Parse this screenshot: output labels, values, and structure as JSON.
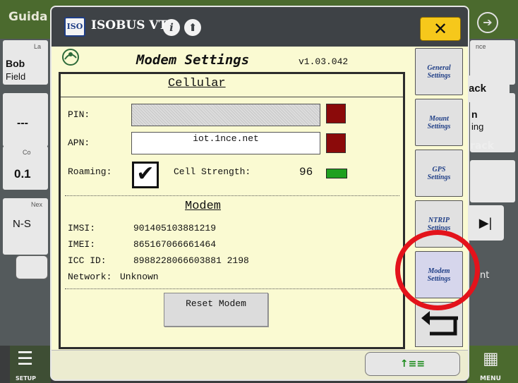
{
  "background_app": {
    "title": "Guida",
    "left_cards": [
      "Bob",
      "Field",
      "---",
      "0.1",
      "N-S"
    ],
    "left_card_small_labels": [
      "La",
      "Co",
      "Nex"
    ],
    "right_cards": [
      "ack",
      "n",
      "ing",
      "rack",
      "nt"
    ],
    "right_small_label": "nce",
    "setup_label": "SETUP",
    "menu_label": "MENU"
  },
  "dialog": {
    "title": "ISOBUS VT",
    "logo_text": "ISO",
    "close_symbol": "✕",
    "screen_title": "Modem Settings",
    "version": "v1.03.042",
    "cellular": {
      "section_title": "Cellular",
      "pin_label": "PIN:",
      "pin_value": "",
      "apn_label": "APN:",
      "apn_value": "iot.1nce.net",
      "roaming_label": "Roaming:",
      "roaming_checked": true,
      "cell_strength_label": "Cell Strength:",
      "cell_strength_value": "96"
    },
    "modem": {
      "section_title": "Modem",
      "imsi_label": "IMSI:",
      "imsi_value": "901405103881219",
      "imei_label": "IMEI:",
      "imei_value": "865167066661464",
      "icc_label": "ICC ID:",
      "icc_value": "8988228066603881 2198",
      "network_label": "Network:",
      "network_value": "Unknown",
      "reset_label": "Reset Modem"
    },
    "side_nav": [
      {
        "line1": "General",
        "line2": "Settings"
      },
      {
        "line1": "Mount",
        "line2": "Settings"
      },
      {
        "line1": "GPS",
        "line2": "Settings"
      },
      {
        "line1": "NTRIP",
        "line2": "Settings"
      },
      {
        "line1": "Modem",
        "line2": "Settings"
      }
    ],
    "footer_button_symbol": "↑≡≡"
  },
  "colors": {
    "dialog_background": "#fafad2",
    "header_background": "#3e4246",
    "close_button": "#f6c81b",
    "status_red": "#8b0a0a",
    "status_green": "#1fa01f",
    "highlight_circle": "#e3131b",
    "app_green": "#4b6a2e"
  }
}
